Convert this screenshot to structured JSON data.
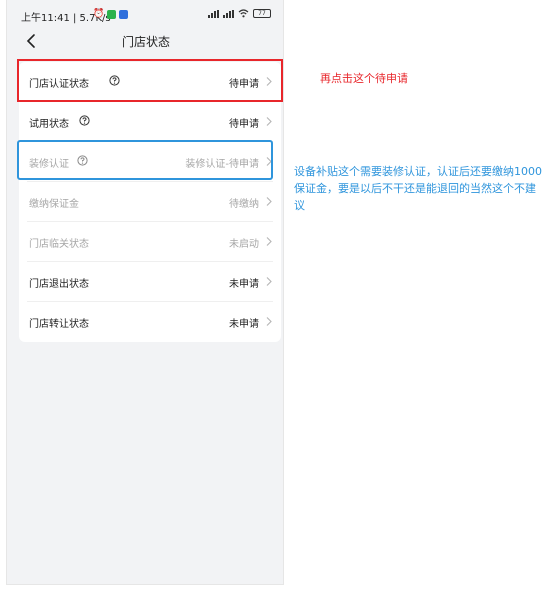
{
  "statusbar": {
    "time": "上午11:41 | 5.7K/s",
    "battery": "77"
  },
  "header": {
    "title": "门店状态"
  },
  "rows": [
    {
      "label": "门店认证状态",
      "status": "待申请",
      "help": true,
      "dim": false
    },
    {
      "label": "试用状态",
      "status": "待申请",
      "help": true,
      "dim": false
    },
    {
      "label": "装修认证",
      "status": "装修认证-待申请",
      "help": true,
      "dim": true
    },
    {
      "label": "缴纳保证金",
      "status": "待缴纳",
      "help": false,
      "dim": true
    },
    {
      "label": "门店临关状态",
      "status": "未启动",
      "help": false,
      "dim": true
    },
    {
      "label": "门店退出状态",
      "status": "未申请",
      "help": false,
      "dim": false
    },
    {
      "label": "门店转让状态",
      "status": "未申请",
      "help": false,
      "dim": false
    }
  ],
  "annotations": {
    "red_note": "再点击这个待申请",
    "blue_note": "设备补贴这个需要装修认证，认证后还要缴纳1000保证金，要是以后不干还是能退回的当然这个不建议"
  },
  "colors": {
    "highlight_red": "#e8262b",
    "highlight_blue": "#2f95dc",
    "page_bg": "#f2f3f5"
  },
  "icons": {
    "back": "chevron-left-icon",
    "help": "question-circle-icon",
    "row_arrow": "chevron-right-icon"
  }
}
